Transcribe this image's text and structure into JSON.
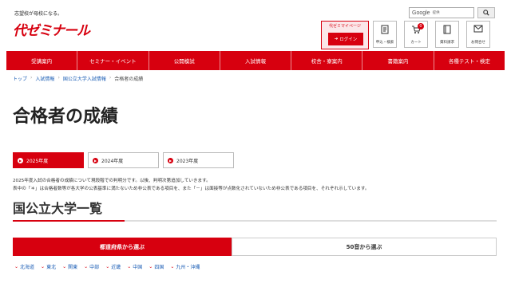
{
  "header": {
    "tagline": "志望校が母校になる。",
    "logo_text": "代ゼミナール",
    "search": {
      "brand": "Google",
      "placeholder": "提供"
    },
    "mypage": {
      "title": "代ゼミマイページ",
      "login_label": "ログイン"
    },
    "icons": [
      {
        "icon": "document-icon",
        "label": "申込・検索"
      },
      {
        "icon": "cart-icon",
        "label": "カート",
        "badge": "0"
      },
      {
        "icon": "book-icon",
        "label": "資料請求"
      },
      {
        "icon": "mail-icon",
        "label": "お問合せ"
      }
    ]
  },
  "nav": {
    "items": [
      "受講案内",
      "セミナー・イベント",
      "公開模試",
      "入試情報",
      "校舎・寮案内",
      "書籍案内",
      "各種テスト・検定"
    ]
  },
  "breadcrumb": [
    "トップ",
    "入試情報",
    "国公立大学入試情報",
    "合格者の成績"
  ],
  "page_title": "合格者の成績",
  "year_tabs": [
    {
      "label": "2025年度",
      "active": true
    },
    {
      "label": "2024年度",
      "active": false
    },
    {
      "label": "2023年度",
      "active": false
    }
  ],
  "notes": [
    "2025年度入試の合格者の成績について現段階での判明分です。以後、判明次第追加していきます。",
    "表中の「＊」は合格者数等が各大学の公表基準に満たないため非公表である項目を、また「－」は面接等が点数化されていないため非公表である項目を、それぞれ示しています。"
  ],
  "section_title": "国公立大学一覧",
  "selector_tabs": [
    "都道府県から選ぶ",
    "50音から選ぶ"
  ],
  "regions": [
    "北海道",
    "東北",
    "関東",
    "中部",
    "近畿",
    "中国",
    "四国",
    "九州・沖縄"
  ],
  "colors": {
    "brand_red": "#d7000f",
    "link_blue": "#1a5db5"
  }
}
